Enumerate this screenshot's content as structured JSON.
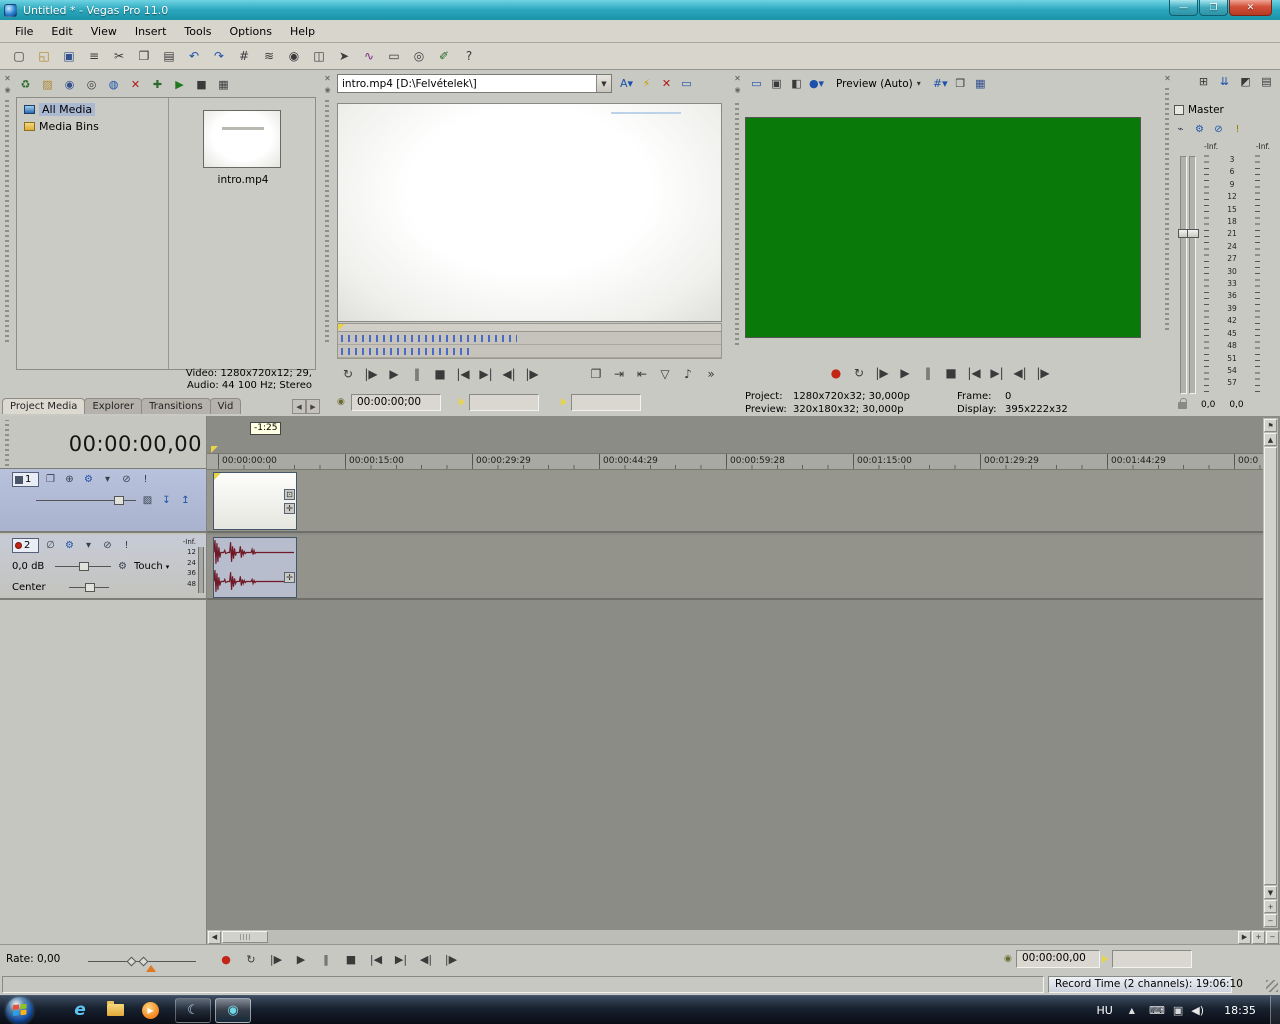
{
  "window": {
    "title": "Untitled * - Vegas Pro 11.0",
    "controls": [
      {
        "name": "minimize-button",
        "glyph": "—"
      },
      {
        "name": "maximize-button",
        "glyph": "❐"
      },
      {
        "name": "close-button",
        "glyph": "✕",
        "cls": "close"
      }
    ]
  },
  "menu": {
    "items": [
      "File",
      "Edit",
      "View",
      "Insert",
      "Tools",
      "Options",
      "Help"
    ]
  },
  "glyphs": {
    "close": "✕",
    "pin": "◉",
    "dropdown": "▾",
    "combo_arrow": "▼",
    "scroll_up": "▲",
    "scroll_down": "▼",
    "scroll_left": "◀",
    "scroll_right": "▶",
    "zoom_in": "+",
    "zoom_out": "−",
    "marker_flag": "⚑",
    "lamp": "◉",
    "gear": "⚙"
  },
  "colors": {
    "titlebar": "#2aa6bc",
    "preview_screen": "#097909",
    "timeline_bg": "#8c8c87",
    "waveform": "#701825"
  },
  "main_toolbar": {
    "icons": [
      {
        "name": "new-project-icon",
        "glyph": "▢"
      },
      {
        "name": "open-project-icon",
        "glyph": "◱",
        "color": "#b08830"
      },
      {
        "name": "save-project-icon",
        "glyph": "▣",
        "color": "#34518e"
      },
      {
        "name": "project-properties-icon",
        "glyph": "≡"
      },
      {
        "name": "cut-icon",
        "glyph": "✂"
      },
      {
        "name": "copy-icon",
        "glyph": "❐"
      },
      {
        "name": "paste-icon",
        "glyph": "▤"
      },
      {
        "name": "undo-icon",
        "glyph": "↶",
        "color": "#1b51a8"
      },
      {
        "name": "redo-icon",
        "glyph": "↷",
        "color": "#1b51a8"
      },
      {
        "name": "enable-snapping-icon",
        "glyph": "#"
      },
      {
        "name": "auto-ripple-icon",
        "glyph": "≋"
      },
      {
        "name": "lock-envelopes-icon",
        "glyph": "◉"
      },
      {
        "name": "ignore-event-grouping-icon",
        "glyph": "◫"
      },
      {
        "name": "normal-edit-tool-icon",
        "glyph": "➤"
      },
      {
        "name": "envelope-edit-tool-icon",
        "glyph": "∿",
        "color": "#7a2a8a"
      },
      {
        "name": "selection-edit-tool-icon",
        "glyph": "▭"
      },
      {
        "name": "zoom-edit-tool-icon",
        "glyph": "◎"
      },
      {
        "name": "interactive-tutorials-icon",
        "glyph": "✐",
        "color": "#2a6a2a"
      },
      {
        "name": "whats-this-help-icon",
        "glyph": "?"
      }
    ]
  },
  "project_media": {
    "toolbar_icons": [
      {
        "name": "remove-all-unused-media-icon",
        "glyph": "♻",
        "color": "#2a6a2a"
      },
      {
        "name": "import-media-icon",
        "glyph": "▨",
        "color": "#b08830"
      },
      {
        "name": "capture-video-icon",
        "glyph": "◉",
        "color": "#34518e"
      },
      {
        "name": "extract-audio-from-cd-icon",
        "glyph": "◎"
      },
      {
        "name": "get-media-from-web-icon",
        "glyph": "◍",
        "color": "#1b51a8"
      },
      {
        "name": "remove-selected-media-icon",
        "glyph": "✕",
        "color": "#b11616"
      },
      {
        "name": "media-fx-icon",
        "glyph": "✚",
        "color": "#2a6a2a"
      },
      {
        "name": "start-preview-icon",
        "glyph": "▶",
        "color": "#1d7a1d"
      },
      {
        "name": "stop-preview-icon",
        "glyph": "■"
      },
      {
        "name": "media-views-icon",
        "glyph": "▦"
      }
    ],
    "tree": [
      {
        "name": "tree-item-all-media",
        "label": "All Media",
        "active": true
      },
      {
        "name": "tree-item-media-bins",
        "label": "Media Bins"
      }
    ],
    "clip_label": "intro.mp4",
    "info_video": "Video: 1280x720x12; 29,",
    "info_audio": "Audio: 44 100 Hz; Stereo",
    "tabs": [
      {
        "name": "tab-project-media",
        "label": "Project Media",
        "active": true
      },
      {
        "name": "tab-explorer",
        "label": "Explorer"
      },
      {
        "name": "tab-transitions",
        "label": "Transitions"
      },
      {
        "name": "tab-video-fx",
        "label": "Vid"
      }
    ]
  },
  "trimmer": {
    "history_value": "intro.mp4   [D:\\Felvételek\\]",
    "header_icons": [
      {
        "name": "sort-trimmer-history-icon",
        "glyph": "A▾",
        "color": "#1b51a8"
      },
      {
        "name": "trimmer-media-fx-icon",
        "glyph": "⚡",
        "color": "#c8a000"
      },
      {
        "name": "remove-from-history-icon",
        "glyph": "✕",
        "color": "#b11616"
      },
      {
        "name": "show-video-monitor-icon",
        "glyph": "▭",
        "color": "#1b51a8"
      }
    ],
    "transport_icons": [
      {
        "name": "loop-playback-icon",
        "glyph": "↻"
      },
      {
        "name": "play-from-start-icon",
        "glyph": "|▶"
      },
      {
        "name": "play-icon",
        "glyph": "▶"
      },
      {
        "name": "pause-icon",
        "glyph": "‖"
      },
      {
        "name": "stop-icon",
        "glyph": "■"
      },
      {
        "name": "go-to-start-icon",
        "glyph": "|◀"
      },
      {
        "name": "go-to-end-icon",
        "glyph": "▶|"
      },
      {
        "name": "previous-frame-icon",
        "glyph": "◀|"
      },
      {
        "name": "next-frame-icon",
        "glyph": "|▶"
      }
    ],
    "right_icons": [
      {
        "name": "create-subclip-icon",
        "glyph": "❐"
      },
      {
        "name": "add-media-from-cursor-icon",
        "glyph": "⇥"
      },
      {
        "name": "add-media-up-to-cursor-icon",
        "glyph": "⇤"
      },
      {
        "name": "save-trimmer-markers-icon",
        "glyph": "▽"
      },
      {
        "name": "open-in-audio-editor-icon",
        "glyph": "♪"
      },
      {
        "name": "overflow-chevron-icon",
        "glyph": "»"
      }
    ],
    "timecode": "00:00:00;00"
  },
  "preview": {
    "toolbar": {
      "icons_left": [
        {
          "name": "external-monitor-icon",
          "glyph": "▭",
          "color": "#1b51a8"
        },
        {
          "name": "video-output-fx-icon",
          "glyph": "▣"
        },
        {
          "name": "split-screen-view-icon",
          "glyph": "◧"
        },
        {
          "name": "split-screen-select-icon",
          "glyph": "●▾",
          "color": "#1b51a8"
        }
      ],
      "mode_label": "Preview (Auto)",
      "icons_right": [
        {
          "name": "overlays-grid-icon",
          "glyph": "#▾",
          "color": "#1b51a8"
        },
        {
          "name": "copy-snapshot-icon",
          "glyph": "❐"
        },
        {
          "name": "save-snapshot-icon",
          "glyph": "▦",
          "color": "#34518e"
        }
      ]
    },
    "transport_icons": [
      {
        "name": "record-icon",
        "glyph": "●",
        "color": "#c22516"
      },
      {
        "name": "loop-playback-icon",
        "glyph": "↻"
      },
      {
        "name": "play-from-start-icon",
        "glyph": "|▶"
      },
      {
        "name": "play-icon",
        "glyph": "▶"
      },
      {
        "name": "pause-icon",
        "glyph": "‖"
      },
      {
        "name": "stop-icon",
        "glyph": "■"
      },
      {
        "name": "go-to-start-icon",
        "glyph": "|◀"
      },
      {
        "name": "go-to-end-icon",
        "glyph": "▶|"
      },
      {
        "name": "previous-frame-icon",
        "glyph": "◀|"
      },
      {
        "name": "next-frame-icon",
        "glyph": "|▶"
      }
    ],
    "status": {
      "project_label": "Project:",
      "project_value": "1280x720x32; 30,000p",
      "frame_label": "Frame:",
      "frame_value": "0",
      "preview_label": "Preview:",
      "preview_value": "320x180x32; 30,000p",
      "display_label": "Display:",
      "display_value": "395x222x32"
    }
  },
  "master": {
    "toolbar_icons": [
      {
        "name": "insert-bus-icon",
        "glyph": "⊞"
      },
      {
        "name": "mixer-downmix-icon",
        "glyph": "⇊",
        "color": "#1b51a8"
      },
      {
        "name": "mixer-dim-icon",
        "glyph": "◩"
      },
      {
        "name": "mixer-properties-icon",
        "glyph": "▤"
      }
    ],
    "title": "Master",
    "strip_icons": [
      {
        "name": "master-plugin-icon",
        "glyph": "⌁"
      },
      {
        "name": "master-fx-icon",
        "glyph": "⚙",
        "color": "#1b51a8"
      },
      {
        "name": "master-mute-icon",
        "glyph": "⊘",
        "color": "#1b51a8"
      },
      {
        "name": "master-solo-icon",
        "glyph": "!",
        "color": "#9a7a00"
      }
    ],
    "inf_left": "-Inf.",
    "inf_right": "-Inf.",
    "db_scale": [
      "3",
      "6",
      "9",
      "12",
      "15",
      "18",
      "21",
      "24",
      "27",
      "30",
      "33",
      "36",
      "39",
      "42",
      "45",
      "48",
      "51",
      "54",
      "57"
    ],
    "value_left": "0,0",
    "value_right": "0,0"
  },
  "timeline": {
    "big_time": "00:00:00,00",
    "snap_offset": "-1:25",
    "ruler_labels": [
      "00:00:00:00",
      "00:00:15:00",
      "00:00:29:29",
      "00:00:44:29",
      "00:00:59:28",
      "00:01:15:00",
      "00:01:29:29",
      "00:01:44:29",
      "00:0"
    ],
    "track1": {
      "number": "1",
      "icons": [
        {
          "name": "compositing-mode-icon",
          "glyph": "❐"
        },
        {
          "name": "track-motion-icon",
          "glyph": "⊕"
        },
        {
          "name": "track-fx-icon",
          "glyph": "⚙",
          "color": "#1b51a8"
        },
        {
          "name": "automation-settings-icon",
          "glyph": "▾"
        },
        {
          "name": "track-mute-icon",
          "glyph": "⊘"
        },
        {
          "name": "track-solo-icon",
          "glyph": "!"
        }
      ],
      "row2_icons": [
        {
          "name": "bypass-motion-blur-icon",
          "glyph": "▨"
        },
        {
          "name": "make-compositing-child-icon",
          "glyph": "↧",
          "color": "#1b51a8"
        },
        {
          "name": "make-compositing-parent-icon",
          "glyph": "↥",
          "color": "#1b51a8"
        }
      ],
      "event_icons": [
        {
          "name": "event-pan-crop-icon",
          "glyph": "⊡"
        },
        {
          "name": "event-fx-icon",
          "glyph": "✛"
        }
      ]
    },
    "track2": {
      "number": "2",
      "icons": [
        {
          "name": "invert-phase-icon",
          "glyph": "∅"
        },
        {
          "name": "track-fx-icon",
          "glyph": "⚙",
          "color": "#1b51a8"
        },
        {
          "name": "automation-settings-icon",
          "glyph": "▾"
        },
        {
          "name": "track-mute-icon",
          "glyph": "⊘"
        },
        {
          "name": "track-solo-icon",
          "glyph": "!"
        }
      ],
      "volume": "0,0 dB",
      "automation_mode": "Touch",
      "pan": "Center",
      "meter_inf": "-Inf.",
      "meter_scale": [
        "12",
        "24",
        "36",
        "48"
      ],
      "event_icons": [
        {
          "name": "event-fx-icon",
          "glyph": "✛"
        }
      ]
    },
    "rate_label": "Rate: 0,00",
    "transport_icons": [
      {
        "name": "record-icon",
        "glyph": "●",
        "color": "#c22516"
      },
      {
        "name": "loop-playback-icon",
        "glyph": "↻"
      },
      {
        "name": "play-from-start-icon",
        "glyph": "|▶"
      },
      {
        "name": "play-icon",
        "glyph": "▶"
      },
      {
        "name": "pause-icon",
        "glyph": "‖"
      },
      {
        "name": "stop-icon",
        "glyph": "■"
      },
      {
        "name": "go-to-start-icon",
        "glyph": "|◀"
      },
      {
        "name": "go-to-end-icon",
        "glyph": "▶|"
      },
      {
        "name": "previous-frame-icon",
        "glyph": "◀|"
      },
      {
        "name": "next-frame-icon",
        "glyph": "|▶"
      }
    ],
    "transport_timecode": "00:00:00,00",
    "record_time_status": "Record Time (2 channels): 19:06:10"
  },
  "taskbar": {
    "pinned": [
      {
        "name": "internet-explorer-icon",
        "glyph": "e",
        "color": "#5ec3f2",
        "cls": "ie"
      },
      {
        "name": "windows-explorer-icon",
        "glyph": "",
        "cls": "folder"
      },
      {
        "name": "media-player-icon",
        "glyph": "▶",
        "color": "#ffffff",
        "cls": "wmp"
      }
    ],
    "running": [
      {
        "name": "app-window-button",
        "glyph": "☾",
        "color": "#bcd8f0"
      },
      {
        "name": "vegas-pro-taskbar-button",
        "glyph": "◉",
        "color": "#6fd6e6",
        "cls": "active"
      }
    ],
    "tray": {
      "language": "HU",
      "expand_glyph": "▲",
      "icons": [
        {
          "name": "input-indicator-icon",
          "glyph": "⌨",
          "color": "#e8e8e8"
        },
        {
          "name": "network-icon",
          "glyph": "▣",
          "color": "#d8d8d8"
        },
        {
          "name": "volume-icon",
          "glyph": "◀)",
          "color": "#e8e8e8"
        }
      ],
      "time": "18:35"
    }
  }
}
